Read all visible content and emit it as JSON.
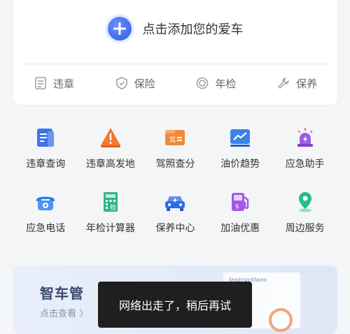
{
  "add_car": {
    "label": "点击添加您的爱车"
  },
  "shortcuts": [
    {
      "label": "违章",
      "icon": "document-icon"
    },
    {
      "label": "保险",
      "icon": "shield-check-icon"
    },
    {
      "label": "年检",
      "icon": "target-icon"
    },
    {
      "label": "保养",
      "icon": "wrench-icon"
    }
  ],
  "grid": [
    {
      "label": "违章查询",
      "icon": "violation-query-icon"
    },
    {
      "label": "违章高发地",
      "icon": "warning-triangle-icon"
    },
    {
      "label": "驾照查分",
      "icon": "license-icon"
    },
    {
      "label": "油价趋势",
      "icon": "trend-chart-icon"
    },
    {
      "label": "应急助手",
      "icon": "alarm-light-icon"
    },
    {
      "label": "应急电话",
      "icon": "phone-icon"
    },
    {
      "label": "年检计算器",
      "icon": "calculator-icon"
    },
    {
      "label": "保养中心",
      "icon": "car-service-icon"
    },
    {
      "label": "加油优惠",
      "icon": "fuel-pump-icon"
    },
    {
      "label": "周边服务",
      "icon": "location-pin-icon"
    }
  ],
  "banner": {
    "title": "智车管",
    "link": "点击查看 〉",
    "art_title": "Instructions"
  },
  "toast": {
    "message": "网络出走了，稍后再试"
  },
  "colors": {
    "accent": "#2f5bea",
    "toast_bg": "#1f1f1f"
  }
}
